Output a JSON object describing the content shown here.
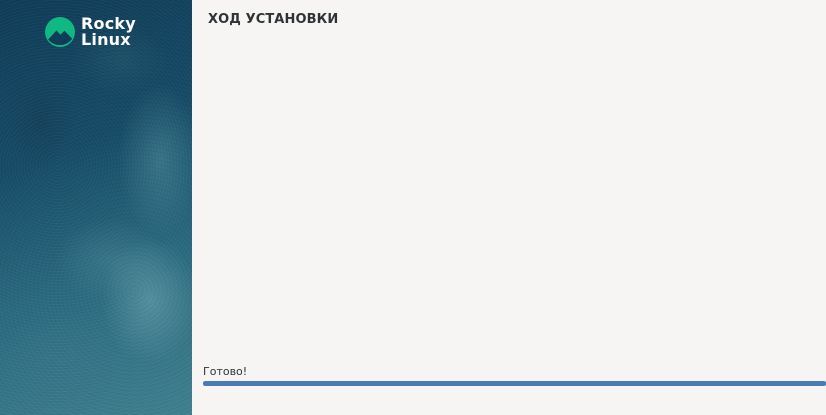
{
  "sidebar": {
    "logo": {
      "line1": "Rocky",
      "line2": "Linux",
      "icon": "rocky-linux-logo-icon",
      "accent_color": "#10b981"
    }
  },
  "main": {
    "title": "ХОД УСТАНОВКИ",
    "status": "Готово!",
    "progress_fraction": 1.0,
    "progress_color": "#4a7bb5"
  }
}
